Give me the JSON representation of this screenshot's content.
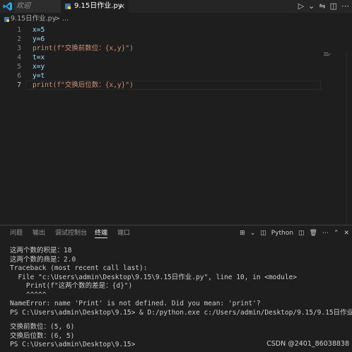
{
  "tabs": {
    "welcome_label": "欢迎",
    "active_label": "9.15日作业.py",
    "close_glyph": "×"
  },
  "breadcrumb": {
    "file": "9.15日作业.py",
    "more": "> ..."
  },
  "editor": {
    "line_numbers": [
      "1",
      "2",
      "3",
      "4",
      "5",
      "6",
      "7"
    ],
    "lines": [
      "x=5",
      "y=6",
      "print(f\"交换前数位：{x,y}\")",
      "t=x",
      "x=y",
      "y=t",
      "print(f\"交换后位数：{x,y}\")"
    ]
  },
  "panel": {
    "tabs": [
      "问题",
      "输出",
      "调试控制台",
      "终端",
      "端口"
    ],
    "active_tab": "终端",
    "shell_label": "Python",
    "terminal_lines": [
      "这两个数的积是：18",
      "这两个数的商是：2.0",
      "Traceback (most recent call last):",
      "  File \"c:\\Users\\admin\\Desktop\\9.15\\9.15日作业.py\", line 10, in <module>",
      "    Print(f\"这两个数的差是：{d}\")",
      "    ^^^^^",
      "NameError: name 'Print' is not defined. Did you mean: 'print'?",
      "PS C:\\Users\\admin\\Desktop\\9.15> & D:/python.exe c:/Users/admin/Desktop/9.15/9.15日作业.py",
      "",
      "交换前数位：(5, 6)",
      "交换后位数：(6, 5)",
      "PS C:\\Users\\admin\\Desktop\\9.15>"
    ]
  },
  "watermark": "CSDN @2401_86038838",
  "colors": {
    "background": "#1e1e1e",
    "tab_bar": "#252526",
    "accent_blue": "#007acc",
    "terminal_exe_yellow": "#e5e510"
  }
}
